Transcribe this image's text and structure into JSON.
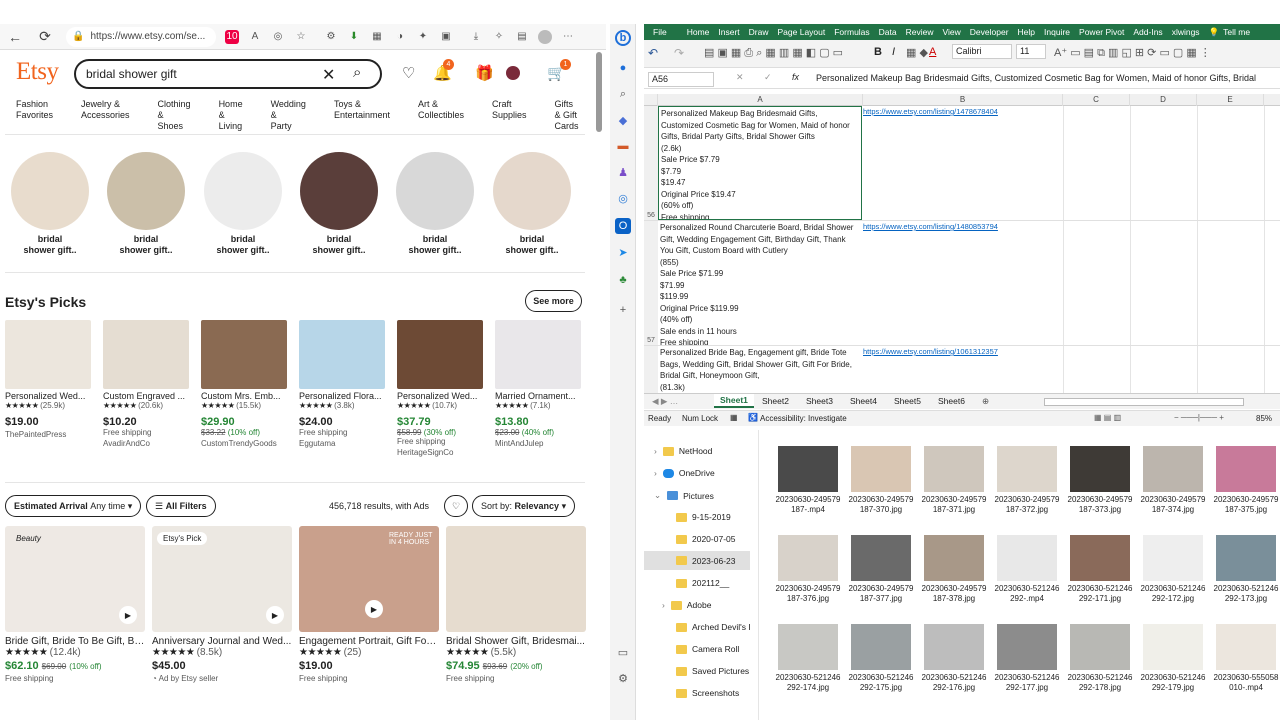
{
  "browser": {
    "url": "https://www.etsy.com/se...",
    "ext_badge": "10"
  },
  "etsy": {
    "logo": "Etsy",
    "search_value": "bridal shower gift",
    "notif_count": "4",
    "cart_count": "1",
    "categories": [
      [
        "Fashion",
        "Favorites"
      ],
      [
        "Jewelry &",
        "Accessories"
      ],
      [
        "Clothing &",
        "Shoes"
      ],
      [
        "Home &",
        "Living"
      ],
      [
        "Wedding &",
        "Party"
      ],
      [
        "Toys &",
        "Entertainment"
      ],
      [
        "Art &",
        "Collectibles"
      ],
      [
        "Craft",
        "Supplies"
      ],
      [
        "Gifts & Gift",
        "Cards"
      ]
    ],
    "circles": [
      {
        "l1": "bridal",
        "l2": "shower gift.."
      },
      {
        "l1": "bridal",
        "l2": "shower gift.."
      },
      {
        "l1": "bridal",
        "l2": "shower gift.."
      },
      {
        "l1": "bridal",
        "l2": "shower gift.."
      },
      {
        "l1": "bridal",
        "l2": "shower gift.."
      },
      {
        "l1": "bridal",
        "l2": "shower gift.."
      }
    ],
    "picks_title": "Etsy's Picks",
    "see_more": "See more",
    "picks": [
      {
        "title": "Personalized Wed...",
        "reviews": "(25.9k)",
        "price": "$19.00",
        "l2": "",
        "orig": "",
        "pct": "",
        "shop": "ThePaintedPress"
      },
      {
        "title": "Custom Engraved ...",
        "reviews": "(20.6k)",
        "price": "$10.20",
        "l2": "Free shipping",
        "orig": "",
        "pct": "",
        "shop": "AvadirAndCo"
      },
      {
        "title": "Custom Mrs. Emb...",
        "reviews": "(15.5k)",
        "price": "$29.90",
        "l2": "",
        "orig": "$33.22",
        "pct": "(10% off)",
        "shop": "CustomTrendyGoods"
      },
      {
        "title": "Personalized Flora...",
        "reviews": "(3.8k)",
        "price": "$24.00",
        "l2": "Free shipping",
        "orig": "",
        "pct": "",
        "shop": "Eggutama"
      },
      {
        "title": "Personalized Wed...",
        "reviews": "(10.7k)",
        "price": "$37.79",
        "l2": "Free shipping",
        "orig": "$58.99",
        "pct": "(30% off)",
        "shop": "HeritageSignCo"
      },
      {
        "title": "Married Ornament...",
        "reviews": "(7.1k)",
        "price": "$13.80",
        "l2": "",
        "orig": "$23.00",
        "pct": "(40% off)",
        "shop": "MintAndJulep"
      }
    ],
    "filters": {
      "arrival_label": "Estimated Arrival",
      "arrival_value": "Any time",
      "all_filters": "All Filters",
      "results": "456,718 results, with Ads",
      "sort_label": "Sort by:",
      "sort_value": "Relevancy"
    },
    "products": [
      {
        "title": "Bride Gift, Bride To Be Gift, Br...",
        "reviews": "(12.4k)",
        "price": "$62.10",
        "orig": "$69.00",
        "pct": "(10% off)",
        "sub": "Free shipping",
        "badge": "Beauty"
      },
      {
        "title": "Anniversary Journal and Wed...",
        "reviews": "(8.5k)",
        "price": "$45.00",
        "orig": "",
        "pct": "",
        "sub": "Ad by Etsy seller",
        "badge": "Etsy's Pick"
      },
      {
        "title": "Engagement Portrait, Gift For ...",
        "reviews": "(25)",
        "price": "$19.00",
        "orig": "",
        "pct": "",
        "sub": "Free shipping",
        "badge": "READY JUST IN 4 HOURS"
      },
      {
        "title": "Bridal Shower Gift, Bridesmai...",
        "reviews": "(5.5k)",
        "price": "$74.95",
        "orig": "$93.69",
        "pct": "(20% off)",
        "sub": "Free shipping",
        "badge": ""
      }
    ]
  },
  "excel": {
    "menu": [
      "File",
      "Home",
      "Insert",
      "Draw",
      "Page Layout",
      "Formulas",
      "Data",
      "Review",
      "View",
      "Developer",
      "Help",
      "Inquire",
      "Power Pivot",
      "Add-Ins",
      "xlwings",
      "Tell me"
    ],
    "font": "Calibri",
    "font_size": "11",
    "namebox": "A56",
    "formula": "Personalized Makeup Bag Bridesmaid Gifts, Customized Cosmetic Bag for Women, Maid of honor Gifts, Bridal",
    "columns": [
      "A",
      "B",
      "C",
      "D",
      "E"
    ],
    "rows": [
      {
        "num": "56",
        "a": "Personalized Makeup Bag Bridesmaid Gifts,\nCustomized Cosmetic Bag for Women, Maid of honor\nGifts, Bridal Party Gifts, Bridal Shower Gifts\n(2.6k)\nSale Price $7.79\n$7.79\n$19.47\nOriginal Price $19.47\n(60% off)\nFree shipping",
        "b": "https://www.etsy.com/listing/1478678404"
      },
      {
        "num": "57",
        "a": "Personalized Round Charcuterie Board, Bridal Shower\nGift, Wedding Engagement Gift, Birthday Gift, Thank\nYou Gift, Custom Board with Cutlery\n(855)\nSale Price $71.99\n$71.99\n$119.99\nOriginal Price $119.99\n(40% off)\nSale ends in 11 hours\nFree shipping",
        "b": "https://www.etsy.com/listing/1480853794"
      },
      {
        "num": "",
        "a": "Personalized Bride Bag, Engagement gift, Bride Tote\nBags, Wedding Gift, Bridal Shower Gift, Gift For Bride,\nBridal Gift, Honeymoon Gift,\n(81.3k)",
        "b": "https://www.etsy.com/listing/1061312357"
      }
    ],
    "sheets": [
      "Sheet1",
      "Sheet2",
      "Sheet3",
      "Sheet4",
      "Sheet5",
      "Sheet6"
    ],
    "status": {
      "ready": "Ready",
      "numlock": "Num Lock",
      "access": "Accessibility: Investigate",
      "zoom": "85%"
    }
  },
  "explorer": {
    "tree": [
      "NetHood",
      "OneDrive",
      "Pictures",
      "9-15-2019",
      "2020-07-05",
      "2023-06-23",
      "202112__",
      "Adobe",
      "Arched Devil's I",
      "Camera Roll",
      "Saved Pictures",
      "Screenshots"
    ],
    "files": [
      [
        "20230630-249579",
        "187-.mp4"
      ],
      [
        "20230630-249579",
        "187-370.jpg"
      ],
      [
        "20230630-249579",
        "187-371.jpg"
      ],
      [
        "20230630-249579",
        "187-372.jpg"
      ],
      [
        "20230630-249579",
        "187-373.jpg"
      ],
      [
        "20230630-249579",
        "187-374.jpg"
      ],
      [
        "20230630-249579",
        "187-375.jpg"
      ],
      [
        "20230630-249579",
        "187-376.jpg"
      ],
      [
        "20230630-249579",
        "187-377.jpg"
      ],
      [
        "20230630-249579",
        "187-378.jpg"
      ],
      [
        "20230630-521246",
        "292-.mp4"
      ],
      [
        "20230630-521246",
        "292-171.jpg"
      ],
      [
        "20230630-521246",
        "292-172.jpg"
      ],
      [
        "20230630-521246",
        "292-173.jpg"
      ],
      [
        "20230630-521246",
        "292-174.jpg"
      ],
      [
        "20230630-521246",
        "292-175.jpg"
      ],
      [
        "20230630-521246",
        "292-176.jpg"
      ],
      [
        "20230630-521246",
        "292-177.jpg"
      ],
      [
        "20230630-521246",
        "292-178.jpg"
      ],
      [
        "20230630-521246",
        "292-179.jpg"
      ],
      [
        "20230630-555058",
        "010-.mp4"
      ]
    ]
  }
}
